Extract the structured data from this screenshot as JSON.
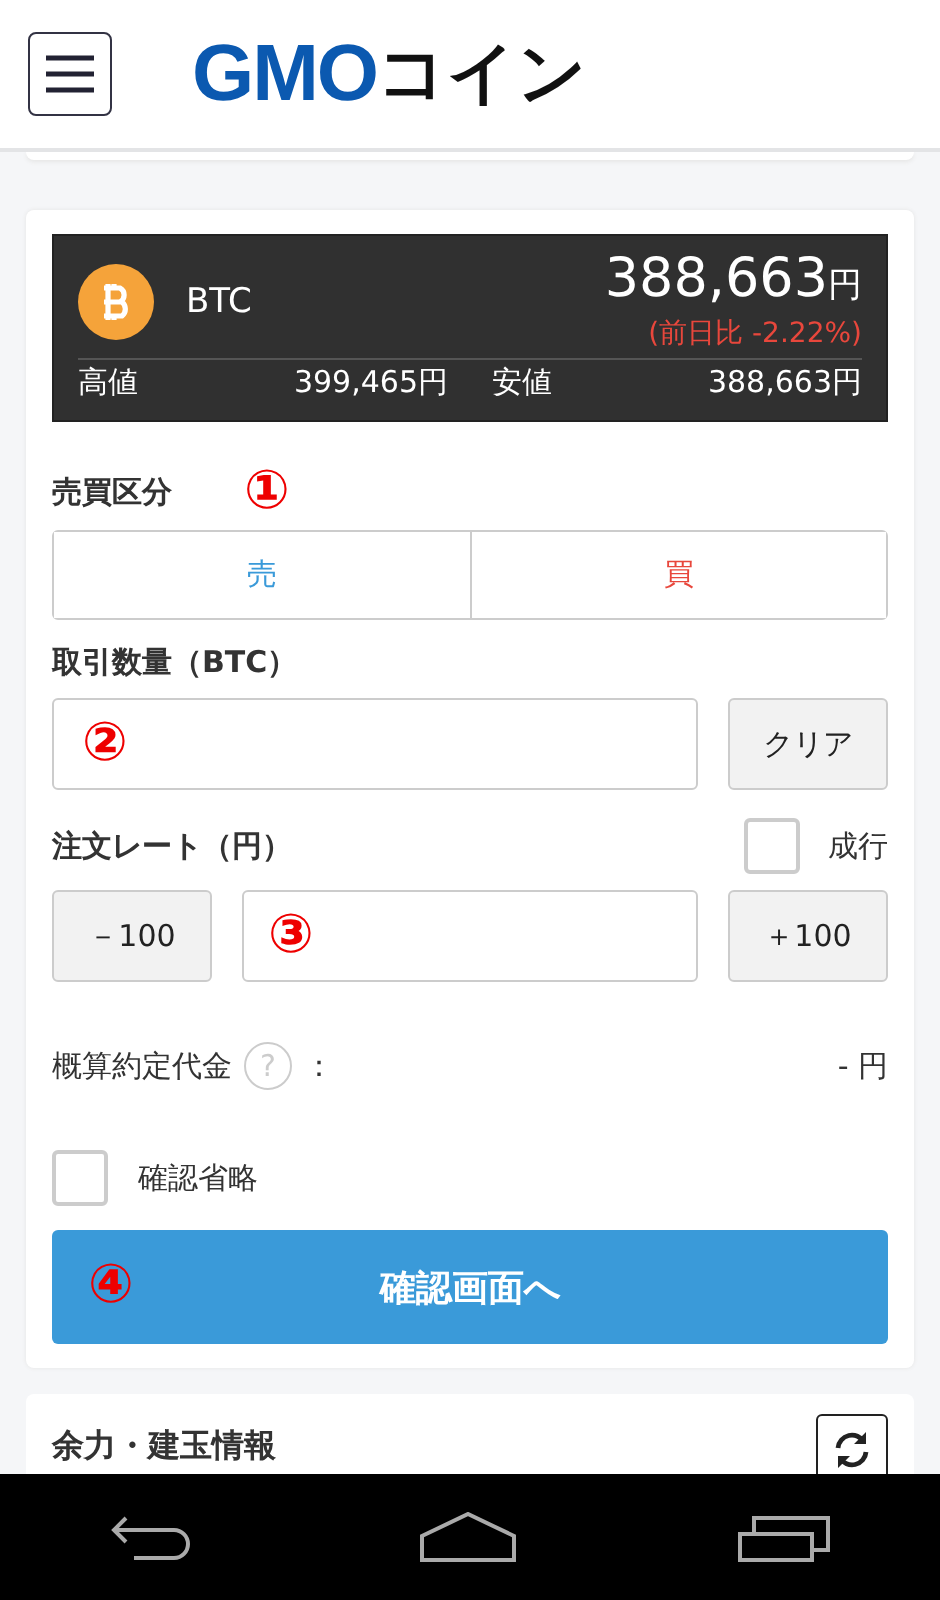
{
  "header": {
    "logo_primary": "GMO",
    "logo_secondary": "コイン"
  },
  "ticker": {
    "symbol": "BTC",
    "price": "388,663",
    "price_unit": "円",
    "change": "(前日比 -2.22%)",
    "high_label": "高値",
    "high": "399,465円",
    "low_label": "安値",
    "low": "388,663円"
  },
  "side": {
    "label": "売買区分",
    "marker": "①",
    "options": [
      {
        "label": "売",
        "selected": false,
        "color": "#3a9ad9"
      },
      {
        "label": "買",
        "selected": false,
        "color": "#e8473c"
      }
    ]
  },
  "quantity": {
    "label": "取引数量（BTC）",
    "marker": "②",
    "clear_button": "クリア"
  },
  "rate": {
    "label": "注文レート（円）",
    "market": {
      "label": "成行",
      "checked": false
    },
    "minus_button": "－100",
    "plus_button": "＋100",
    "marker": "③"
  },
  "estimate": {
    "label": "概算約定代金",
    "help": "?",
    "colon": "：",
    "value": "- 円"
  },
  "skip_confirm": {
    "label": "確認省略",
    "checked": false
  },
  "submit": {
    "label": "確認画面へ",
    "marker": "④"
  },
  "next_section": {
    "title": "余力・建玉情報"
  }
}
